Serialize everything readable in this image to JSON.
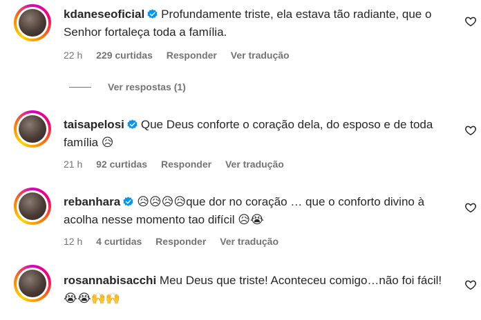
{
  "comments": [
    {
      "username": "kdaneseoficial",
      "verified": true,
      "text": "Profundamente triste, ela estava tão radiante, que o Senhor fortaleça toda a família.",
      "time": "22 h",
      "likes": "229 curtidas",
      "reply_label": "Responder",
      "translate_label": "Ver tradução"
    },
    {
      "username": "taisapelosi",
      "verified": true,
      "text": "Que Deus conforte o coração dela, do esposo e de toda família 😥",
      "time": "21 h",
      "likes": "92 curtidas",
      "reply_label": "Responder",
      "translate_label": "Ver tradução"
    },
    {
      "username": "rebanhara",
      "verified": true,
      "text": "😥😥😥😥que dor no coração … que o conforto divino à acolha nesse momento tao difícil 😥😭",
      "time": "12 h",
      "likes": "4 curtidas",
      "reply_label": "Responder",
      "translate_label": "Ver tradução"
    },
    {
      "username": "rosannabisacchi",
      "verified": false,
      "text": "Meu Deus que triste! Aconteceu comigo…não foi fácil! 😭😭🙌🙌"
    }
  ],
  "view_replies_label": "Ver respostas (1)",
  "icons": {
    "verified": "verified-badge-icon",
    "like": "heart-outline-icon"
  },
  "colors": {
    "verified_blue": "#0095f6",
    "meta_gray": "#737373",
    "text": "#262626"
  }
}
